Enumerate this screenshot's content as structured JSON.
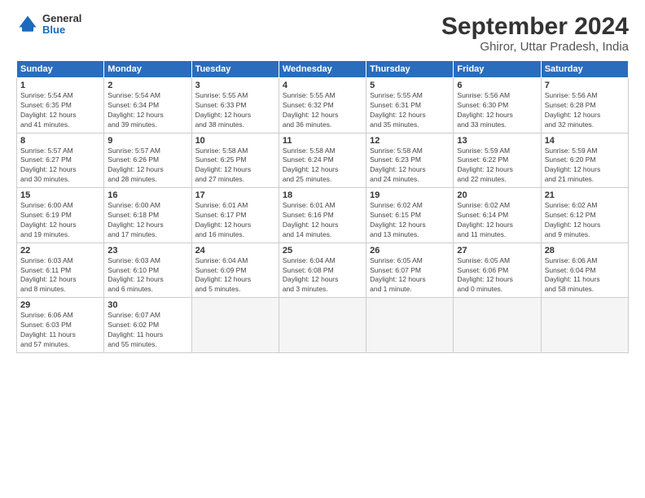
{
  "logo": {
    "general": "General",
    "blue": "Blue"
  },
  "title": "September 2024",
  "subtitle": "Ghiror, Uttar Pradesh, India",
  "headers": [
    "Sunday",
    "Monday",
    "Tuesday",
    "Wednesday",
    "Thursday",
    "Friday",
    "Saturday"
  ],
  "weeks": [
    [
      {
        "num": "1",
        "info": "Sunrise: 5:54 AM\nSunset: 6:35 PM\nDaylight: 12 hours\nand 41 minutes."
      },
      {
        "num": "2",
        "info": "Sunrise: 5:54 AM\nSunset: 6:34 PM\nDaylight: 12 hours\nand 39 minutes."
      },
      {
        "num": "3",
        "info": "Sunrise: 5:55 AM\nSunset: 6:33 PM\nDaylight: 12 hours\nand 38 minutes."
      },
      {
        "num": "4",
        "info": "Sunrise: 5:55 AM\nSunset: 6:32 PM\nDaylight: 12 hours\nand 36 minutes."
      },
      {
        "num": "5",
        "info": "Sunrise: 5:55 AM\nSunset: 6:31 PM\nDaylight: 12 hours\nand 35 minutes."
      },
      {
        "num": "6",
        "info": "Sunrise: 5:56 AM\nSunset: 6:30 PM\nDaylight: 12 hours\nand 33 minutes."
      },
      {
        "num": "7",
        "info": "Sunrise: 5:56 AM\nSunset: 6:28 PM\nDaylight: 12 hours\nand 32 minutes."
      }
    ],
    [
      {
        "num": "8",
        "info": "Sunrise: 5:57 AM\nSunset: 6:27 PM\nDaylight: 12 hours\nand 30 minutes."
      },
      {
        "num": "9",
        "info": "Sunrise: 5:57 AM\nSunset: 6:26 PM\nDaylight: 12 hours\nand 28 minutes."
      },
      {
        "num": "10",
        "info": "Sunrise: 5:58 AM\nSunset: 6:25 PM\nDaylight: 12 hours\nand 27 minutes."
      },
      {
        "num": "11",
        "info": "Sunrise: 5:58 AM\nSunset: 6:24 PM\nDaylight: 12 hours\nand 25 minutes."
      },
      {
        "num": "12",
        "info": "Sunrise: 5:58 AM\nSunset: 6:23 PM\nDaylight: 12 hours\nand 24 minutes."
      },
      {
        "num": "13",
        "info": "Sunrise: 5:59 AM\nSunset: 6:22 PM\nDaylight: 12 hours\nand 22 minutes."
      },
      {
        "num": "14",
        "info": "Sunrise: 5:59 AM\nSunset: 6:20 PM\nDaylight: 12 hours\nand 21 minutes."
      }
    ],
    [
      {
        "num": "15",
        "info": "Sunrise: 6:00 AM\nSunset: 6:19 PM\nDaylight: 12 hours\nand 19 minutes."
      },
      {
        "num": "16",
        "info": "Sunrise: 6:00 AM\nSunset: 6:18 PM\nDaylight: 12 hours\nand 17 minutes."
      },
      {
        "num": "17",
        "info": "Sunrise: 6:01 AM\nSunset: 6:17 PM\nDaylight: 12 hours\nand 16 minutes."
      },
      {
        "num": "18",
        "info": "Sunrise: 6:01 AM\nSunset: 6:16 PM\nDaylight: 12 hours\nand 14 minutes."
      },
      {
        "num": "19",
        "info": "Sunrise: 6:02 AM\nSunset: 6:15 PM\nDaylight: 12 hours\nand 13 minutes."
      },
      {
        "num": "20",
        "info": "Sunrise: 6:02 AM\nSunset: 6:14 PM\nDaylight: 12 hours\nand 11 minutes."
      },
      {
        "num": "21",
        "info": "Sunrise: 6:02 AM\nSunset: 6:12 PM\nDaylight: 12 hours\nand 9 minutes."
      }
    ],
    [
      {
        "num": "22",
        "info": "Sunrise: 6:03 AM\nSunset: 6:11 PM\nDaylight: 12 hours\nand 8 minutes."
      },
      {
        "num": "23",
        "info": "Sunrise: 6:03 AM\nSunset: 6:10 PM\nDaylight: 12 hours\nand 6 minutes."
      },
      {
        "num": "24",
        "info": "Sunrise: 6:04 AM\nSunset: 6:09 PM\nDaylight: 12 hours\nand 5 minutes."
      },
      {
        "num": "25",
        "info": "Sunrise: 6:04 AM\nSunset: 6:08 PM\nDaylight: 12 hours\nand 3 minutes."
      },
      {
        "num": "26",
        "info": "Sunrise: 6:05 AM\nSunset: 6:07 PM\nDaylight: 12 hours\nand 1 minute."
      },
      {
        "num": "27",
        "info": "Sunrise: 6:05 AM\nSunset: 6:06 PM\nDaylight: 12 hours\nand 0 minutes."
      },
      {
        "num": "28",
        "info": "Sunrise: 6:06 AM\nSunset: 6:04 PM\nDaylight: 11 hours\nand 58 minutes."
      }
    ],
    [
      {
        "num": "29",
        "info": "Sunrise: 6:06 AM\nSunset: 6:03 PM\nDaylight: 11 hours\nand 57 minutes."
      },
      {
        "num": "30",
        "info": "Sunrise: 6:07 AM\nSunset: 6:02 PM\nDaylight: 11 hours\nand 55 minutes."
      },
      {
        "num": "",
        "info": ""
      },
      {
        "num": "",
        "info": ""
      },
      {
        "num": "",
        "info": ""
      },
      {
        "num": "",
        "info": ""
      },
      {
        "num": "",
        "info": ""
      }
    ]
  ]
}
